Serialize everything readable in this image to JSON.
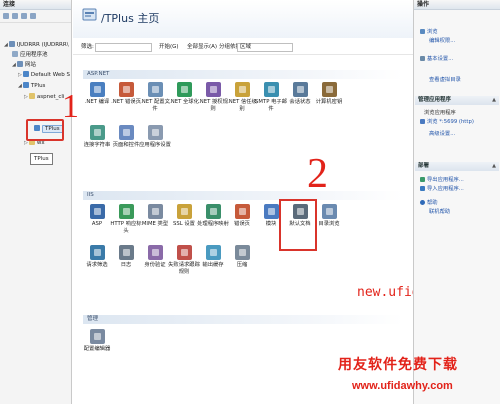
{
  "left_pane": {
    "title": "连接",
    "tree": [
      {
        "text": "IJUDRRR (IJUDRRR\\",
        "twisty": "◢",
        "color": "#6d8fb8"
      },
      {
        "text": "应用程序池",
        "twisty": "",
        "color": "#8fa9c7"
      },
      {
        "text": "网站",
        "twisty": "◢",
        "color": "#6d8fb8"
      },
      {
        "text": "Default Web S",
        "twisty": "▷",
        "color": "#4c86c8"
      },
      {
        "text": "TPlus",
        "twisty": "◢",
        "color": "#4c86c8"
      },
      {
        "text": "aspnet_cli",
        "twisty": "▷",
        "color": "#e0c36a"
      },
      {
        "text": "TPlus",
        "twisty": "",
        "color": "#4c86c8"
      },
      {
        "text": "wx",
        "twisty": "▷",
        "color": "#e0c36a"
      }
    ],
    "tooltip": "TPlus"
  },
  "center": {
    "title": "/TPlus 主页",
    "filter": {
      "label": "筛选:",
      "go": "开始(G)",
      "show_all": "全部显示(A)",
      "group_by": "分组依据:",
      "group_value": "区域"
    },
    "groups": [
      {
        "name": "ASP.NET",
        "items": [
          {
            "label": ".NET 编译",
            "color": "#4a7fc0"
          },
          {
            "label": ".NET 错误页",
            "color": "#c65a3a"
          },
          {
            "label": ".NET 配置文件",
            "color": "#6b8fb5"
          },
          {
            "label": ".NET 全球化",
            "color": "#2f9a5a"
          },
          {
            "label": ".NET 授权规则",
            "color": "#7a5aa8"
          },
          {
            "label": ".NET 信任级别",
            "color": "#c9a23a"
          },
          {
            "label": "SMTP 电子邮件",
            "color": "#3a8fb0"
          },
          {
            "label": "会话状态",
            "color": "#5a7a9a"
          },
          {
            "label": "计算机密钥",
            "color": "#8a6a3a"
          },
          {
            "label": "连接字符串",
            "color": "#4a9a8a"
          },
          {
            "label": "页面和控件",
            "color": "#6a8ac0"
          },
          {
            "label": "应用程序设置",
            "color": "#8a9ab0"
          }
        ]
      },
      {
        "name": "IIS",
        "items": [
          {
            "label": "ASP",
            "color": "#3a6aa8"
          },
          {
            "label": "HTTP 响应标头",
            "color": "#3a9a5a"
          },
          {
            "label": "MIME 类型",
            "color": "#7a8aa0"
          },
          {
            "label": "SSL 设置",
            "color": "#c9a23a"
          },
          {
            "label": "处理程序映射",
            "color": "#3a8f6a"
          },
          {
            "label": "错误页",
            "color": "#c65a3a"
          },
          {
            "label": "模块",
            "color": "#4a7ac0"
          },
          {
            "label": "默认文档",
            "color": "#5a6a7a"
          },
          {
            "label": "目录浏览",
            "color": "#6a8ab0"
          },
          {
            "label": "请求筛选",
            "color": "#3a7aa8"
          },
          {
            "label": "日志",
            "color": "#6a7a8a"
          },
          {
            "label": "身份验证",
            "color": "#8a6aa8"
          },
          {
            "label": "失败请求跟踪规则",
            "color": "#c0504a"
          },
          {
            "label": "输出缓存",
            "color": "#4a9ac0"
          },
          {
            "label": "压缩",
            "color": "#7a8a9a"
          }
        ]
      },
      {
        "name": "管理",
        "items": [
          {
            "label": "配置编辑器",
            "color": "#7a8aa0"
          }
        ]
      }
    ],
    "annotations": {
      "one": "1",
      "two": "2"
    },
    "watermark_url": "new.ufidawhy.com"
  },
  "right_pane": {
    "title": "操作",
    "items": [
      {
        "label": "浏览",
        "kind": "link"
      },
      {
        "label": "编辑权限...",
        "kind": "link"
      },
      {
        "label": "基本设置...",
        "kind": "link"
      },
      {
        "label": "查看虚拟目录",
        "kind": "link"
      }
    ],
    "section_manage": {
      "title": "管理应用程序",
      "browse_head": "浏览应用程序",
      "browse_link": "浏览 *:5699 (http)",
      "advanced": "高级设置..."
    },
    "section_deploy": {
      "title": "部署",
      "export": "导出应用程序...",
      "import": "导入应用程序..."
    },
    "help": "帮助",
    "online_help": "联机帮助"
  },
  "brand": {
    "text": "用友软件免费下载",
    "url": "www.ufidawhy.com"
  }
}
